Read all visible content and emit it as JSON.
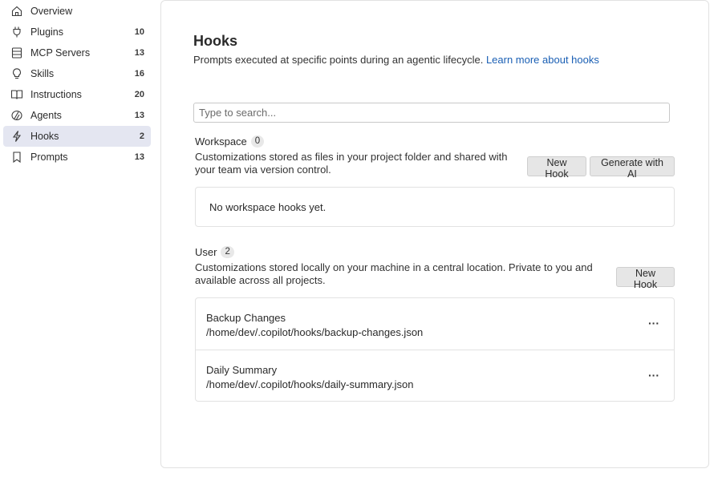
{
  "sidebar": {
    "items": [
      {
        "label": "Overview",
        "count": "",
        "icon": "home-icon"
      },
      {
        "label": "Plugins",
        "count": "10",
        "icon": "plug-icon"
      },
      {
        "label": "MCP Servers",
        "count": "13",
        "icon": "server-icon"
      },
      {
        "label": "Skills",
        "count": "16",
        "icon": "lightbulb-icon"
      },
      {
        "label": "Instructions",
        "count": "20",
        "icon": "book-icon"
      },
      {
        "label": "Agents",
        "count": "13",
        "icon": "agent-icon"
      },
      {
        "label": "Hooks",
        "count": "2",
        "icon": "lightning-icon",
        "active": true
      },
      {
        "label": "Prompts",
        "count": "13",
        "icon": "bookmark-icon"
      }
    ]
  },
  "main": {
    "title": "Hooks",
    "description": "Prompts executed at specific points during an agentic lifecycle.",
    "learn_more": "Learn more about hooks",
    "search_placeholder": "Type to search..."
  },
  "workspace": {
    "title": "Workspace",
    "count": "0",
    "description_line1": "Customizations stored as files in your project folder and shared with",
    "description_line2": "your team via version control.",
    "new_hook_label": "New Hook",
    "generate_label": "Generate with AI",
    "empty_text": "No workspace hooks yet."
  },
  "user": {
    "title": "User",
    "count": "2",
    "description_line1": "Customizations stored locally on your machine in a central location. Private to you and",
    "description_line2": "available across all projects.",
    "new_hook_label": "New Hook",
    "hooks": [
      {
        "name": "Backup Changes",
        "path": "/home/dev/.copilot/hooks/backup-changes.json"
      },
      {
        "name": "Daily Summary",
        "path": "/home/dev/.copilot/hooks/daily-summary.json"
      }
    ],
    "more_label": "···"
  },
  "colors": {
    "accent_link": "#1a5fb4",
    "active_nav_bg": "#e4e6f1",
    "button_bg": "#e6e6e6"
  }
}
